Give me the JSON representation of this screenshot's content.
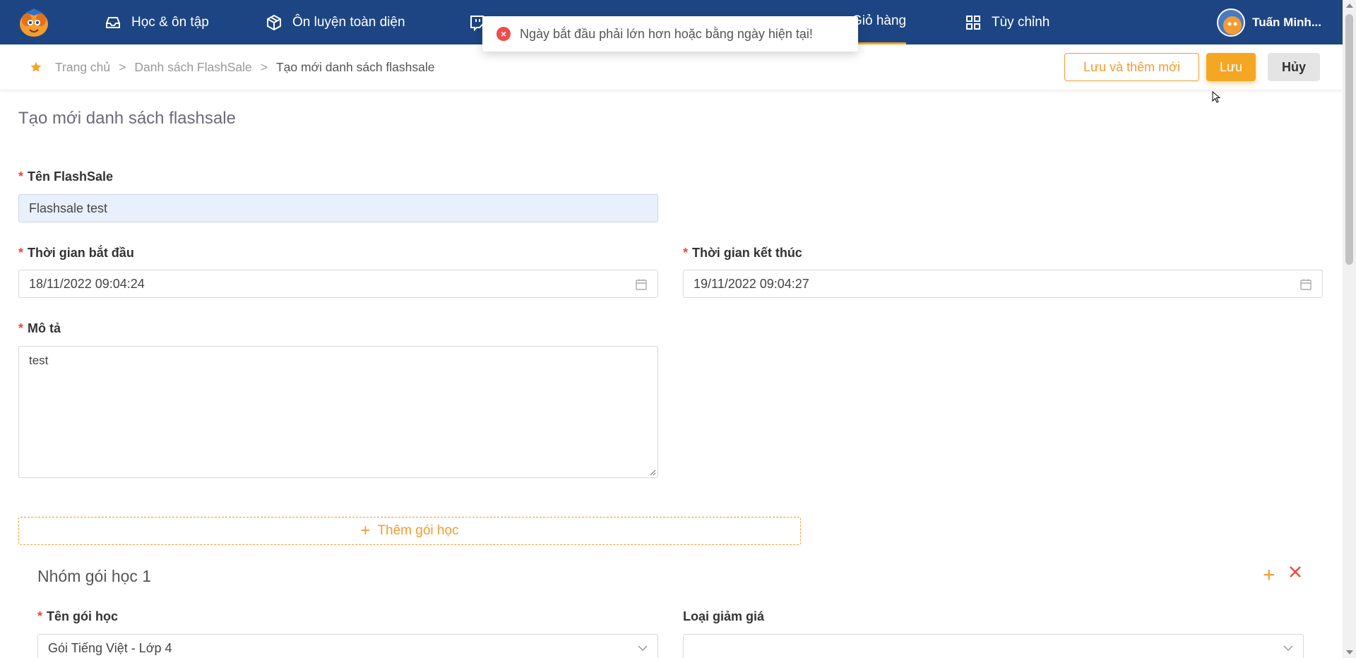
{
  "nav": {
    "items": [
      {
        "label": "Học & ôn tập",
        "icon": "inbox-icon"
      },
      {
        "label": "Ôn luyện toàn diện",
        "icon": "cube-icon"
      },
      {
        "label": "",
        "icon": "twitch-icon"
      },
      {
        "label": "Giỏ hàng",
        "icon": "cart-icon"
      },
      {
        "label": "Tùy chỉnh",
        "icon": "grid-icon"
      }
    ],
    "user_name": "Tuấn Minh..."
  },
  "toast": {
    "message": "Ngày bắt đầu phải lớn hơn hoặc bằng ngày hiện tại!"
  },
  "breadcrumb": {
    "items": [
      "Trang chủ",
      "Danh sách FlashSale",
      "Tạo mới danh sách flashsale"
    ],
    "separator": ">"
  },
  "actions": {
    "save_and_new": "Lưu và thêm mới",
    "save": "Lưu",
    "cancel": "Hủy"
  },
  "page": {
    "title": "Tạo mới danh sách flashsale"
  },
  "form": {
    "name_label": "Tên FlashSale",
    "name_value": "Flashsale test",
    "start_label": "Thời gian bắt đầu",
    "start_value": "18/11/2022 09:04:24",
    "end_label": "Thời gian kết thúc",
    "end_value": "19/11/2022 09:04:27",
    "desc_label": "Mô tả",
    "desc_value": "test",
    "required_mark": "*",
    "add_package": "Thêm gói học"
  },
  "group": {
    "title": "Nhóm gói học 1",
    "package_label": "Tên gói học",
    "package_value": "Gói Tiếng Việt - Lớp 4",
    "discount_label": "Loại giảm giá",
    "discount_value": ""
  },
  "colors": {
    "nav_bg": "#1e4583",
    "accent": "#f5a623",
    "error": "#f14c4c"
  }
}
